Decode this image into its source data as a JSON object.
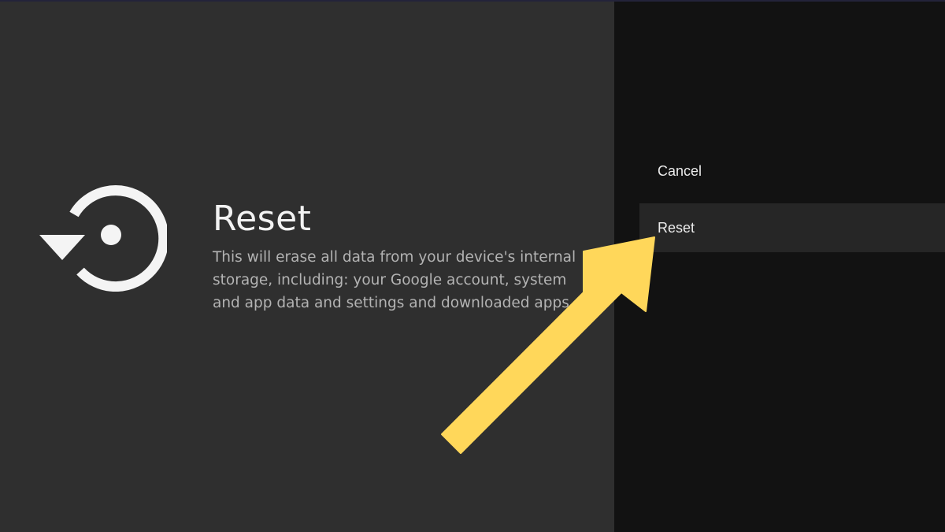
{
  "panel": {
    "icon": "reset-restore-icon",
    "title": "Reset",
    "description": "This will erase all data from your device's internal storage, including: your Google account, system and app data and settings and downloaded apps"
  },
  "actions": {
    "cancel_label": "Cancel",
    "reset_label": "Reset"
  },
  "overlay": {
    "arrow_icon": "pointer-arrow-icon",
    "arrow_color": "#ffd75a"
  },
  "colors": {
    "left_background": "#2f2f2f",
    "right_background": "#121212",
    "focused_option": "#262626"
  }
}
